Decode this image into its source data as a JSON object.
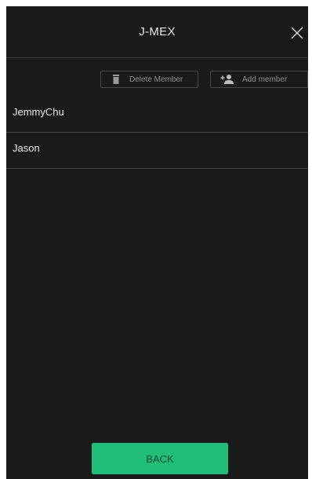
{
  "header": {
    "title": "J-MEX",
    "close_icon": "close-icon"
  },
  "actions": {
    "delete_label": "Delete Member",
    "delete_icon": "trash-icon",
    "add_label": "Add member",
    "add_icon": "add-person-icon"
  },
  "members": [
    {
      "name": "JemmyChu"
    },
    {
      "name": "Jason"
    }
  ],
  "footer": {
    "back_label": "BACK"
  },
  "colors": {
    "background": "#1b1b1b",
    "accent": "#1fbf7a",
    "divider": "#444444"
  }
}
